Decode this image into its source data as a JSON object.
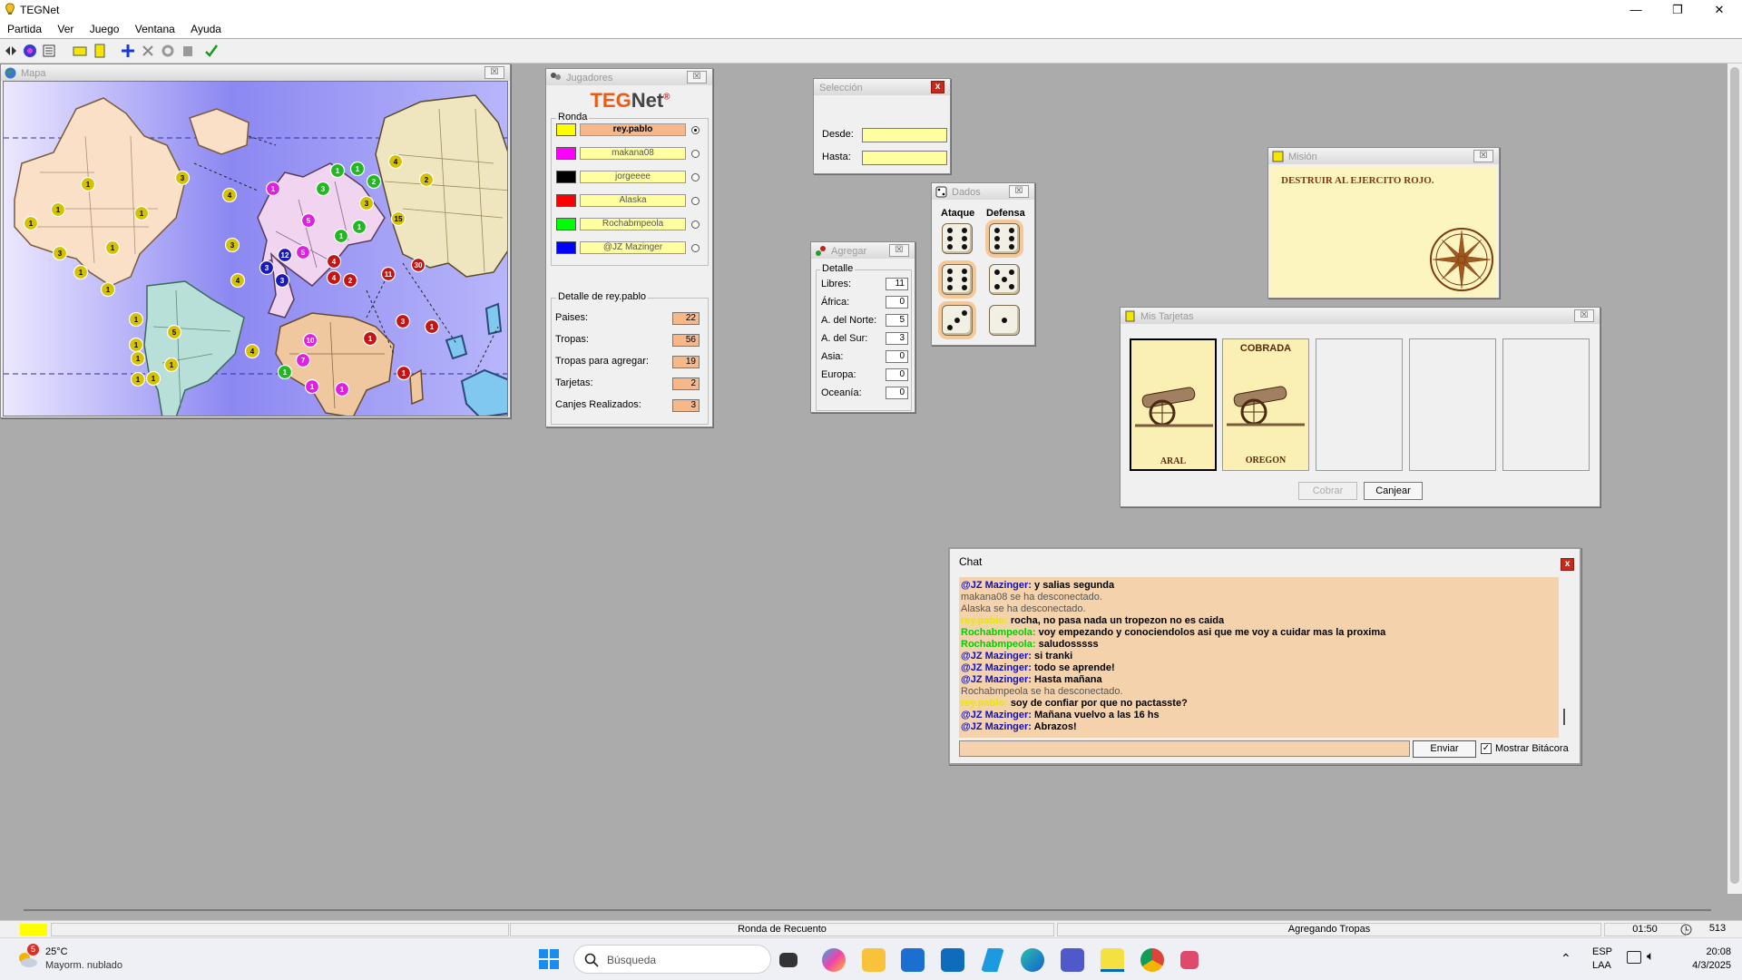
{
  "window": {
    "title": "TEGNet",
    "minimize": "—",
    "restore": "❐",
    "close": "✕"
  },
  "menu": [
    {
      "label": "Partida"
    },
    {
      "label": "Ver"
    },
    {
      "label": "Juego"
    },
    {
      "label": "Ventana"
    },
    {
      "label": "Ayuda"
    }
  ],
  "toolbar_icons": [
    "connect-icon",
    "globe-icon",
    "list-icon",
    "card-icon",
    "mission-icon",
    "add-army-icon",
    "cancel-icon",
    "settings-icon",
    "copy-icon",
    "check-icon"
  ],
  "map_panel": {
    "title": "Mapa",
    "close": "☒",
    "territories": [
      {
        "color": "#d4c200",
        "armies": "1"
      },
      {
        "color": "#d4c200",
        "armies": "3"
      },
      {
        "color": "#d4c200",
        "armies": "1"
      },
      {
        "color": "#d4c200",
        "armies": "1"
      },
      {
        "color": "#d4c200",
        "armies": "1"
      },
      {
        "color": "#d4c200",
        "armies": "3"
      },
      {
        "color": "#d4c200",
        "armies": "1"
      },
      {
        "color": "#d4c200",
        "armies": "1"
      },
      {
        "color": "#d4c200",
        "armies": "1"
      },
      {
        "color": "#d4c200",
        "armies": "1"
      },
      {
        "color": "#d4c200",
        "armies": "4"
      },
      {
        "color": "#d4c200",
        "armies": "3"
      },
      {
        "color": "#d4c200",
        "armies": "4"
      },
      {
        "color": "#e020e0",
        "armies": "1"
      },
      {
        "color": "#e020e0",
        "armies": "5"
      },
      {
        "color": "#e020e0",
        "armies": "5"
      },
      {
        "color": "#1a1ab8",
        "armies": "12"
      },
      {
        "color": "#1a1ab8",
        "armies": "3"
      },
      {
        "color": "#1a1ab8",
        "armies": "3"
      },
      {
        "color": "#21b821",
        "armies": "1"
      },
      {
        "color": "#21b821",
        "armies": "1"
      },
      {
        "color": "#d4c200",
        "armies": "4"
      },
      {
        "color": "#21b821",
        "armies": "3"
      },
      {
        "color": "#21b821",
        "armies": "2"
      },
      {
        "color": "#d4c200",
        "armies": "3"
      },
      {
        "color": "#21b821",
        "armies": "1"
      },
      {
        "color": "#d4c200",
        "armies": "15"
      },
      {
        "color": "#21b821",
        "armies": "1"
      },
      {
        "color": "#d4c200",
        "armies": "2"
      },
      {
        "color": "#c41414",
        "armies": "4"
      },
      {
        "color": "#c41414",
        "armies": "4"
      },
      {
        "color": "#c41414",
        "armies": "2"
      },
      {
        "color": "#c41414",
        "armies": "11"
      },
      {
        "color": "#c41414",
        "armies": "30"
      },
      {
        "color": "#d4c200",
        "armies": "1"
      },
      {
        "color": "#d4c200",
        "armies": "5"
      },
      {
        "color": "#d4c200",
        "armies": "1"
      },
      {
        "color": "#d4c200",
        "armies": "1"
      },
      {
        "color": "#d4c200",
        "armies": "1"
      },
      {
        "color": "#d4c200",
        "armies": "1"
      },
      {
        "color": "#e020e0",
        "armies": "10"
      },
      {
        "color": "#d4c200",
        "armies": "4"
      },
      {
        "color": "#e020e0",
        "armies": "7"
      },
      {
        "color": "#21b821",
        "armies": "1"
      },
      {
        "color": "#e020e0",
        "armies": "1"
      },
      {
        "color": "#e020e0",
        "armies": "1"
      },
      {
        "color": "#c41414",
        "armies": "1"
      },
      {
        "color": "#c41414",
        "armies": "3"
      },
      {
        "color": "#c41414",
        "armies": "1"
      },
      {
        "color": "#c41414",
        "armies": "1"
      }
    ]
  },
  "players_panel": {
    "title": "Jugadores",
    "logo_teg": "TEG",
    "logo_net": "Net",
    "logo_reg": "®",
    "ronda_label": "Ronda",
    "players": [
      {
        "name": "rey.pablo",
        "color": "#ffff00",
        "active": true
      },
      {
        "name": "makana08",
        "color": "#ff00ff",
        "active": false
      },
      {
        "name": "jorgeeee",
        "color": "#000000",
        "active": false
      },
      {
        "name": "Alaska",
        "color": "#ff0000",
        "active": false
      },
      {
        "name": "Rochabmpeola",
        "color": "#00ff00",
        "active": false
      },
      {
        "name": "@JZ Mazinger",
        "color": "#0000ff",
        "active": false
      }
    ],
    "detail_title": "Detalle de rey.pablo",
    "details": [
      {
        "label": "Paises:",
        "value": "22"
      },
      {
        "label": "Tropas:",
        "value": "56"
      },
      {
        "label": "Tropas para agregar:",
        "value": "19"
      },
      {
        "label": "Tarjetas:",
        "value": "2"
      },
      {
        "label": "Canjes Realizados:",
        "value": "3"
      }
    ]
  },
  "selection_panel": {
    "title": "Selección",
    "close": "x",
    "desde_label": "Desde:",
    "hasta_label": "Hasta:",
    "desde_value": "",
    "hasta_value": ""
  },
  "agregar_panel": {
    "title": "Agregar",
    "close": "☒",
    "detail_label": "Detalle",
    "rows": [
      {
        "label": "Libres:",
        "value": "11"
      },
      {
        "label": "África:",
        "value": "0"
      },
      {
        "label": "A. del Norte:",
        "value": "5"
      },
      {
        "label": "A. del Sur:",
        "value": "3"
      },
      {
        "label": "Asia:",
        "value": "0"
      },
      {
        "label": "Europa:",
        "value": "0"
      },
      {
        "label": "Oceanía:",
        "value": "0"
      }
    ]
  },
  "dice_panel": {
    "title": "Dados",
    "close": "☒",
    "attack_label": "Ataque",
    "defense_label": "Defensa",
    "attack": [
      6,
      6,
      3
    ],
    "defense": [
      6,
      5,
      1
    ]
  },
  "mission_panel": {
    "title": "Misión",
    "close": "☒",
    "text": "DESTRUIR AL EJERCITO ROJO."
  },
  "cards_panel": {
    "title": "Mis Tarjetas",
    "close": "☒",
    "cards": [
      {
        "name": "ARAL",
        "status": "",
        "selected": true
      },
      {
        "name": "OREGON",
        "status": "COBRADA",
        "selected": false
      }
    ],
    "cobrar": "Cobrar",
    "canjear": "Canjear"
  },
  "chat_panel": {
    "title": "Chat",
    "close": "x",
    "lines": [
      {
        "name": "@JZ Mazinger:",
        "text": "y salias segunda",
        "name_color": "#1010c0"
      },
      {
        "name": "",
        "text": "makana08 se ha desconectado.",
        "name_color": ""
      },
      {
        "name": "",
        "text": "Alaska se ha desconectado.",
        "name_color": ""
      },
      {
        "name": "rey.pablo:",
        "text": "rocha, no pasa nada un tropezon no es caida",
        "name_color": "#e8e800"
      },
      {
        "name": "Rochabmpeola:",
        "text": "voy empezando y conociendolos asi que me voy a cuidar mas la proxima",
        "name_color": "#00d000"
      },
      {
        "name": "Rochabmpeola:",
        "text": "saludosssss",
        "name_color": "#00d000"
      },
      {
        "name": "@JZ Mazinger:",
        "text": "si tranki",
        "name_color": "#1010c0"
      },
      {
        "name": "@JZ Mazinger:",
        "text": "todo se aprende!",
        "name_color": "#1010c0"
      },
      {
        "name": "@JZ Mazinger:",
        "text": "Hasta mañana",
        "name_color": "#1010c0"
      },
      {
        "name": "",
        "text": "Rochabmpeola se ha desconectado.",
        "name_color": ""
      },
      {
        "name": "rey.pablo:",
        "text": "soy de confiar por que no pactasste?",
        "name_color": "#e8e800"
      },
      {
        "name": "@JZ Mazinger:",
        "text": "Mañana vuelvo a las 16 hs",
        "name_color": "#1010c0"
      },
      {
        "name": "@JZ Mazinger:",
        "text": "Abrazos!",
        "name_color": "#1010c0"
      }
    ],
    "input_value": "",
    "send": "Enviar",
    "show_log": "Mostrar Bitácora",
    "show_log_checked": true
  },
  "status": {
    "round": "Ronda de Recuento",
    "phase": "Agregando Tropas",
    "time": "01:50",
    "count": "513",
    "current_color": "#ffff00"
  },
  "taskbar": {
    "weather_temp": "25°C",
    "weather_desc": "Mayorm. nublado",
    "weather_badge": "5",
    "search_placeholder": "Búsqueda",
    "lang": "ESP",
    "layout": "LAA",
    "time": "20:08",
    "date": "4/3/2025",
    "apps": [
      "task-view-icon",
      "copilot-icon",
      "file-explorer-icon",
      "store-icon",
      "outlook-icon",
      "azure-icon",
      "edge-icon",
      "teams-icon",
      "tegnet-icon",
      "chrome-icon",
      "snipping-icon"
    ]
  }
}
